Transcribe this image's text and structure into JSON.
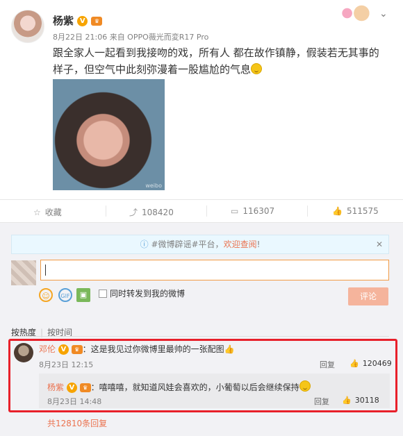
{
  "post": {
    "username": "杨紫",
    "meta": "8月22日 21:06 来自 OPPO薇光而変R17 Pro",
    "text": "跟全家人一起看到我接吻的戏，所有人 都在故作镇静，假装若无其事的样子，但空气中此刻弥漫着一股尴尬的气息",
    "image_watermark": "weibo"
  },
  "actions": {
    "favorite_label": "收藏",
    "forward_count": "108420",
    "comment_count": "116307",
    "like_count": "511575"
  },
  "notice": {
    "prefix": "#微博辟谣#平台，",
    "link": "欢迎查阅",
    "suffix": "!"
  },
  "composer": {
    "input_value": "",
    "forward_label": "同时转发到我的微博",
    "submit_label": "评论"
  },
  "sort": {
    "hot_label": "按热度",
    "time_label": "按时间"
  },
  "comment": {
    "author": "邓伦",
    "text": "：这是我见过你微博里最帅的一张配图",
    "time": "8月23日 12:15",
    "reply_label": "回复",
    "likes": "120469"
  },
  "sub_comment": {
    "author": "杨紫",
    "text": "：嘻嘻嘻，就知道风娃会喜欢的，小葡萄以后会继续保持",
    "time": "8月23日 14:48",
    "reply_label": "回复",
    "likes": "30118"
  },
  "total_replies": "共12810条回复",
  "colors": {
    "accent": "#eb7350",
    "highlight": "#e8202a",
    "vip": "#f7a400"
  }
}
